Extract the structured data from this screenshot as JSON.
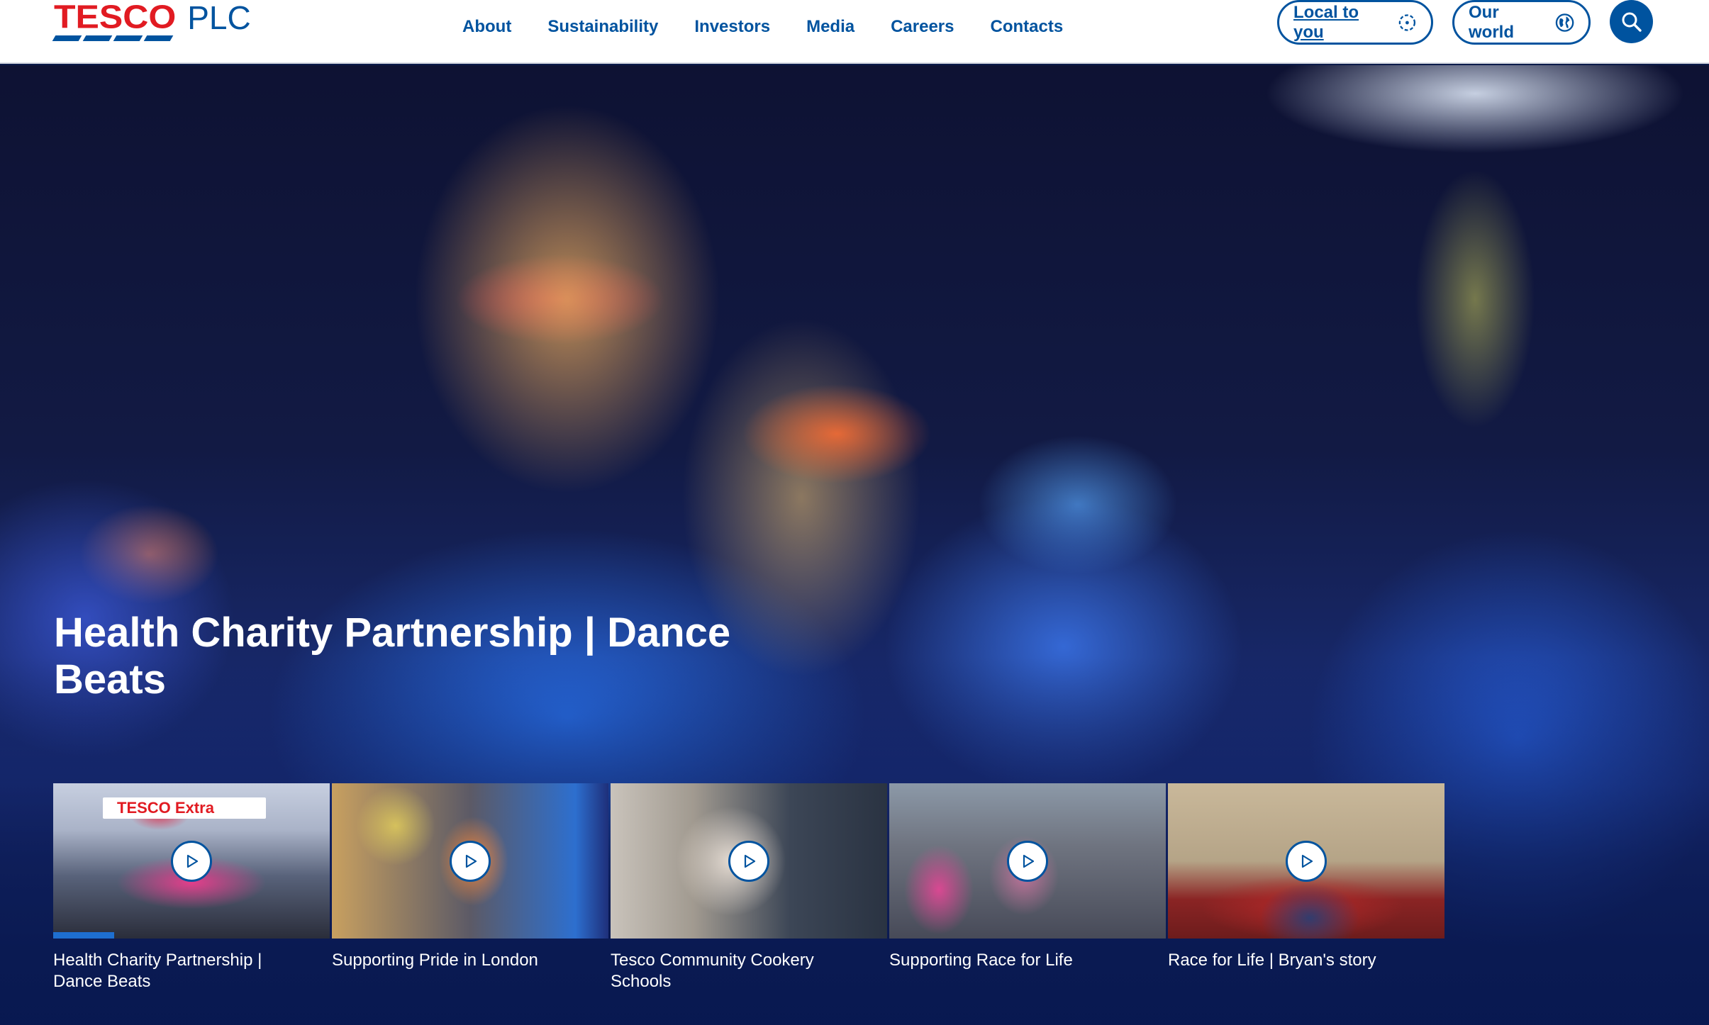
{
  "header": {
    "logo_brand": "TESCO",
    "logo_suffix": "PLC",
    "nav": [
      "About",
      "Sustainability",
      "Investors",
      "Media",
      "Careers",
      "Contacts"
    ],
    "local_label": "Local to you",
    "world_label": "Our world"
  },
  "hero": {
    "title": "Health Charity Partnership | Dance Beats"
  },
  "carousel": {
    "items": [
      {
        "label": "Health Charity Partnership | Dance Beats",
        "thumb_text": "TESCO Extra",
        "progress": 0.22
      },
      {
        "label": "Supporting Pride in London"
      },
      {
        "label": "Tesco Community Cookery Schools"
      },
      {
        "label": "Supporting Race for Life"
      },
      {
        "label": "Race for Life | Bryan's story"
      }
    ]
  },
  "colors": {
    "brand_blue": "#00539f",
    "brand_red": "#e11b22",
    "progress_blue": "#1e6fd0"
  }
}
